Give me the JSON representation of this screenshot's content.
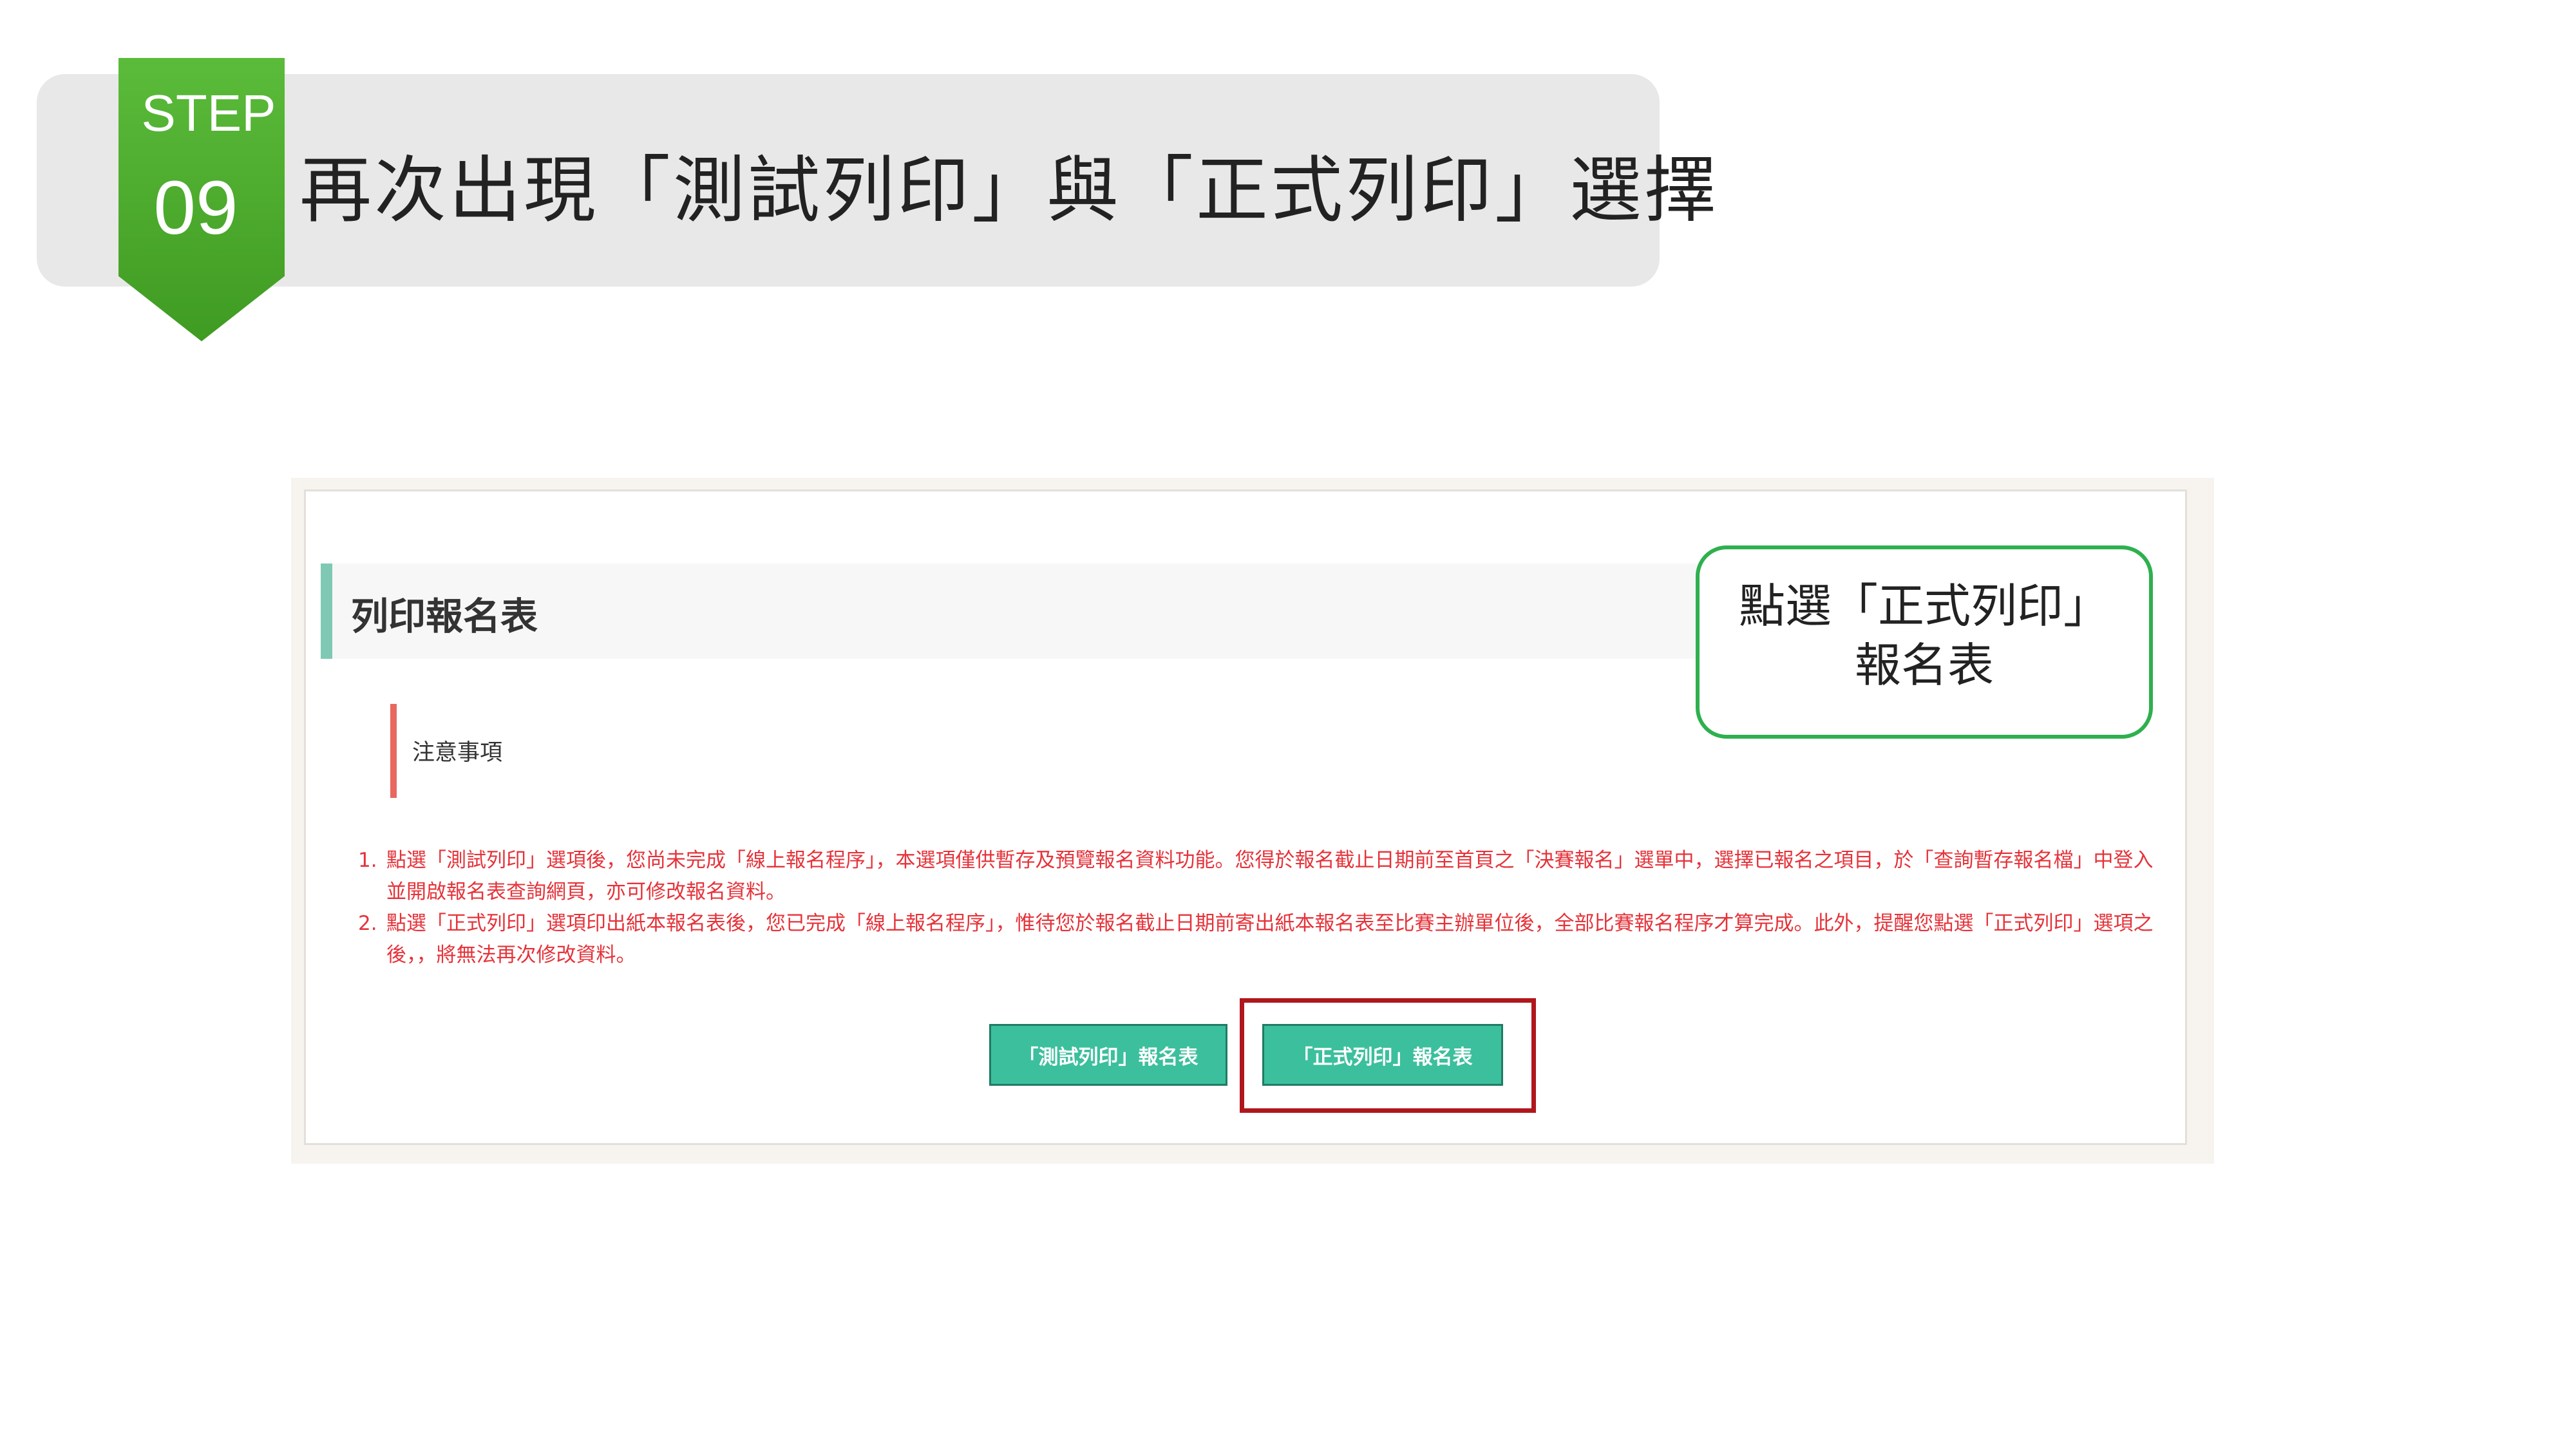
{
  "step": {
    "label": "STEP",
    "number": "09",
    "title": "再次出現「測試列印」與「正式列印」選擇"
  },
  "form": {
    "section_title": "列印報名表",
    "notice_title": "注意事項",
    "notes": [
      {
        "num": "1.",
        "text": "點選「測試列印」選項後，您尚未完成「線上報名程序」，本選項僅供暫存及預覽報名資料功能。您得於報名截止日期前至首頁之「決賽報名」選單中，選擇已報名之項目，於「查詢暫存報名檔」中登入並開啟報名表查詢網頁，亦可修改報名資料。"
      },
      {
        "num": "2.",
        "text": "點選「正式列印」選項印出紙本報名表後，您已完成「線上報名程序」，惟待您於報名截止日期前寄出紙本報名表至比賽主辦單位後，全部比賽報名程序才算完成。此外，提醒您點選「正式列印」選項之後，，將無法再次修改資料。"
      }
    ],
    "buttons": {
      "test_print": "「測試列印」報名表",
      "formal_print": "「正式列印」報名表"
    }
  },
  "callout": {
    "line1": "點選「正式列印」",
    "line2": "報名表"
  },
  "colors": {
    "step_green": "#4aa92c",
    "button_teal": "#3cbf9d",
    "highlight_red": "#b0171c",
    "notes_red": "#e5333a",
    "callout_green": "#2eb04e"
  }
}
